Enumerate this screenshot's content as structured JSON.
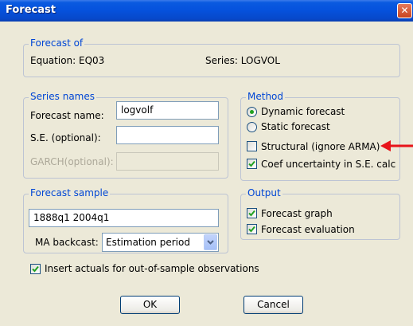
{
  "window": {
    "title": "Forecast"
  },
  "forecast_of": {
    "legend": "Forecast of",
    "equation": "Equation: EQ03",
    "series": "Series: LOGVOL"
  },
  "series_names": {
    "legend": "Series names",
    "forecast_name_label": "Forecast name:",
    "forecast_name_value": "logvolf",
    "se_label": "S.E. (optional):",
    "se_value": "",
    "garch_label": "GARCH(optional):",
    "garch_value": ""
  },
  "method": {
    "legend": "Method",
    "dynamic_label": "Dynamic forecast",
    "static_label": "Static forecast",
    "structural_label": "Structural (ignore ARMA)",
    "coef_label": "Coef uncertainty in S.E. calc",
    "selected": "dynamic",
    "structural_checked": false,
    "coef_checked": true
  },
  "forecast_sample": {
    "legend": "Forecast sample",
    "value": "1888q1 2004q1",
    "ma_backcast_label": "MA backcast:",
    "ma_backcast_selected": "Estimation period"
  },
  "output": {
    "legend": "Output",
    "graph_label": "Forecast graph",
    "graph_checked": true,
    "evaluation_label": "Forecast evaluation",
    "evaluation_checked": true
  },
  "insert_actuals": {
    "label": "Insert actuals for out-of-sample observations",
    "checked": true
  },
  "buttons": {
    "ok": "OK",
    "cancel": "Cancel"
  },
  "annotation": {
    "arrow_color": "#e8141a"
  },
  "icons": {
    "close": "close-icon",
    "check": "check-icon",
    "dropdown": "chevron-down-icon",
    "arrow": "arrow-left-icon"
  }
}
